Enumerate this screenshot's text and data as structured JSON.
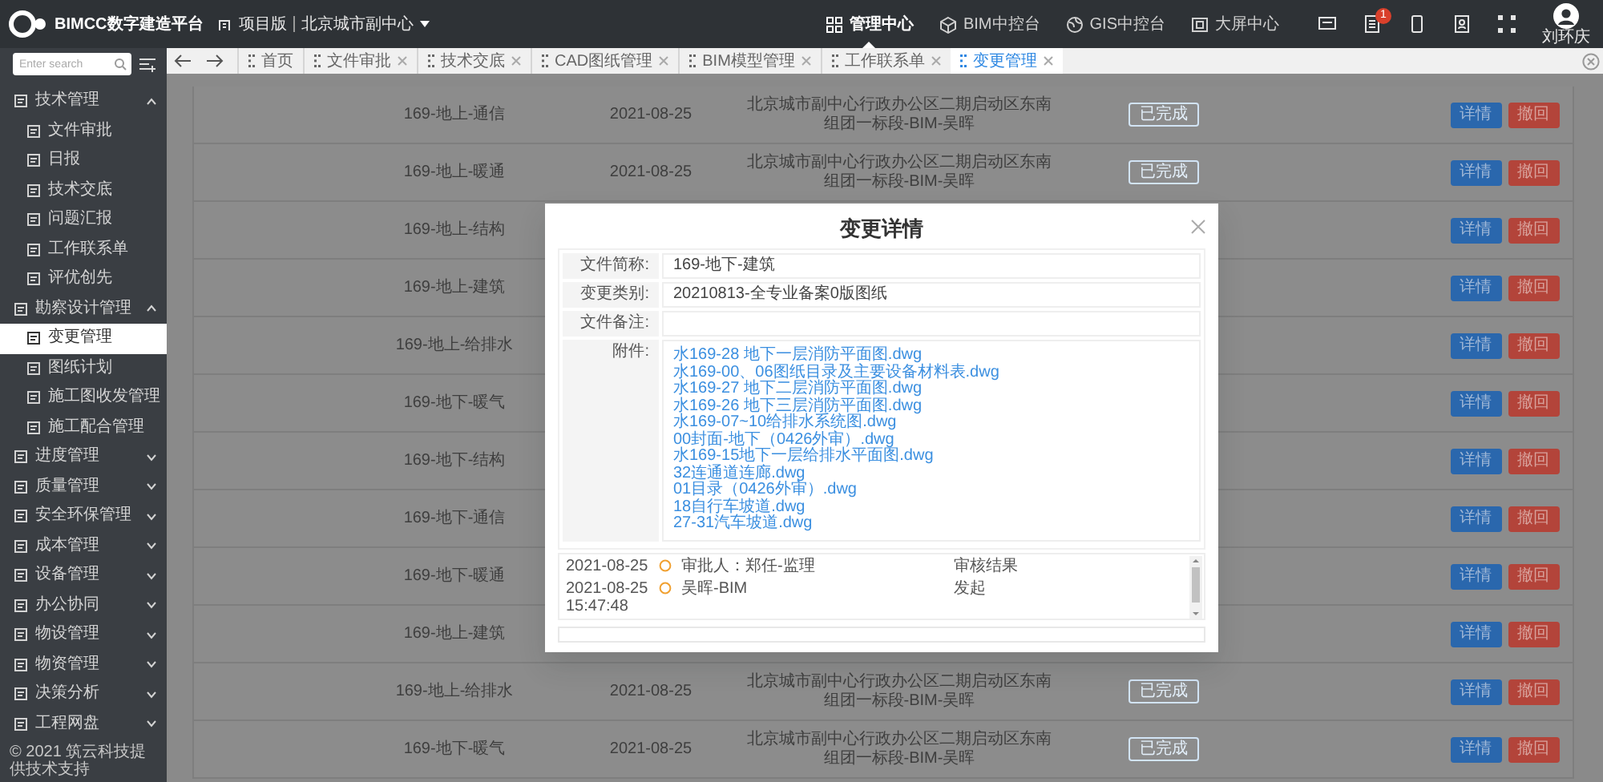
{
  "header": {
    "logo_text": "BIMCC数字建造平台",
    "edition": "项目版",
    "project": "北京城市副中心",
    "nav": [
      {
        "label": "管理中心",
        "selected": true
      },
      {
        "label": "BIM中控台",
        "selected": false
      },
      {
        "label": "GIS中控台",
        "selected": false
      },
      {
        "label": "大屏中心",
        "selected": false
      }
    ],
    "notification_count": "1",
    "user": "刘环庆"
  },
  "sidebar": {
    "search_placeholder": "Enter search",
    "groups": [
      {
        "label": "技术管理",
        "expanded": true,
        "children": [
          {
            "label": "文件审批",
            "selected": false
          },
          {
            "label": "日报",
            "selected": false
          },
          {
            "label": "技术交底",
            "selected": false
          },
          {
            "label": "问题汇报",
            "selected": false
          },
          {
            "label": "工作联系单",
            "selected": false
          },
          {
            "label": "评优创先",
            "selected": false
          }
        ]
      },
      {
        "label": "勘察设计管理",
        "expanded": true,
        "children": [
          {
            "label": "变更管理",
            "selected": true
          },
          {
            "label": "图纸计划",
            "selected": false
          },
          {
            "label": "施工图收发管理",
            "selected": false
          },
          {
            "label": "施工配合管理",
            "selected": false
          }
        ]
      },
      {
        "label": "进度管理",
        "expanded": false
      },
      {
        "label": "质量管理",
        "expanded": false
      },
      {
        "label": "安全环保管理",
        "expanded": false
      },
      {
        "label": "成本管理",
        "expanded": false
      },
      {
        "label": "设备管理",
        "expanded": false
      },
      {
        "label": "办公协同",
        "expanded": false
      },
      {
        "label": "物设管理",
        "expanded": false
      },
      {
        "label": "物资管理",
        "expanded": false
      },
      {
        "label": "决策分析",
        "expanded": false
      },
      {
        "label": "工程网盘",
        "expanded": false
      }
    ],
    "footer": "© 2021 筑云科技提供技术支持"
  },
  "tabs": [
    {
      "label": "首页",
      "closable": false,
      "selected": false
    },
    {
      "label": "文件审批",
      "closable": true,
      "selected": false
    },
    {
      "label": "技术交底",
      "closable": true,
      "selected": false
    },
    {
      "label": "CAD图纸管理",
      "closable": true,
      "selected": false
    },
    {
      "label": "BIM模型管理",
      "closable": true,
      "selected": false
    },
    {
      "label": "工作联系单",
      "closable": true,
      "selected": false
    },
    {
      "label": "变更管理",
      "closable": true,
      "selected": true
    }
  ],
  "table": {
    "rows": [
      {
        "name": "169-地上-通信",
        "date": "2021-08-25",
        "address": "北京城市副中心行政办公区二期启动区东南组团一标段-BIM-吴晖",
        "status": "已完成",
        "actions": [
          "详情",
          "撤回"
        ]
      },
      {
        "name": "169-地上-暖通",
        "date": "2021-08-25",
        "address": "北京城市副中心行政办公区二期启动区东南组团一标段-BIM-吴晖",
        "status": "已完成",
        "actions": [
          "详情",
          "撤回"
        ]
      },
      {
        "name": "169-地上-结构",
        "actions": [
          "详情",
          "撤回"
        ]
      },
      {
        "name": "169-地上-建筑",
        "actions": [
          "详情",
          "撤回"
        ]
      },
      {
        "name": "169-地上-给排水",
        "actions": [
          "详情",
          "撤回"
        ]
      },
      {
        "name": "169-地下-暖气",
        "actions": [
          "详情",
          "撤回"
        ]
      },
      {
        "name": "169-地下-结构",
        "actions": [
          "详情",
          "撤回"
        ]
      },
      {
        "name": "169-地下-通信",
        "actions": [
          "详情",
          "撤回"
        ]
      },
      {
        "name": "169-地下-暖通",
        "actions": [
          "详情",
          "撤回"
        ]
      },
      {
        "name": "169-地上-建筑",
        "actions": [
          "详情",
          "撤回"
        ]
      },
      {
        "name": "169-地上-给排水",
        "date": "2021-08-25",
        "address": "北京城市副中心行政办公区二期启动区东南组团一标段-BIM-吴晖",
        "status": "已完成",
        "actions": [
          "详情",
          "撤回"
        ]
      },
      {
        "name": "169-地下-暖气",
        "date": "2021-08-25",
        "address": "北京城市副中心行政办公区二期启动区东南组团一标段-BIM-吴晖",
        "status": "已完成",
        "actions": [
          "详情",
          "撤回"
        ]
      }
    ]
  },
  "modal": {
    "title": "变更详情",
    "fields": [
      {
        "label": "文件简称:",
        "value": "169-地下-建筑"
      },
      {
        "label": "变更类别:",
        "value": "20210813-全专业备案0版图纸"
      },
      {
        "label": "文件备注:"
      }
    ],
    "attachments_label": "附件:",
    "attachments": [
      "水169-28 地下一层消防平面图.dwg",
      "水169-00、06图纸目录及主要设备材料表.dwg",
      "水169-27 地下二层消防平面图.dwg",
      "水169-26 地下三层消防平面图.dwg",
      "水169-07~10给排水系统图.dwg",
      "00封面-地下（0426外审）.dwg",
      "水169-15地下一层给排水平面图.dwg",
      "32连通道连廊.dwg",
      "01目录（0426外审）.dwg",
      "18自行车坡道.dwg",
      "27-31汽车坡道.dwg"
    ],
    "timeline": [
      {
        "date": "2021-08-25",
        "person": "审批人：郑任-监理",
        "result": "审核结果"
      },
      {
        "date": "2021-08-25 15:47:48",
        "person": "吴晖-BIM",
        "result": "发起"
      }
    ]
  }
}
